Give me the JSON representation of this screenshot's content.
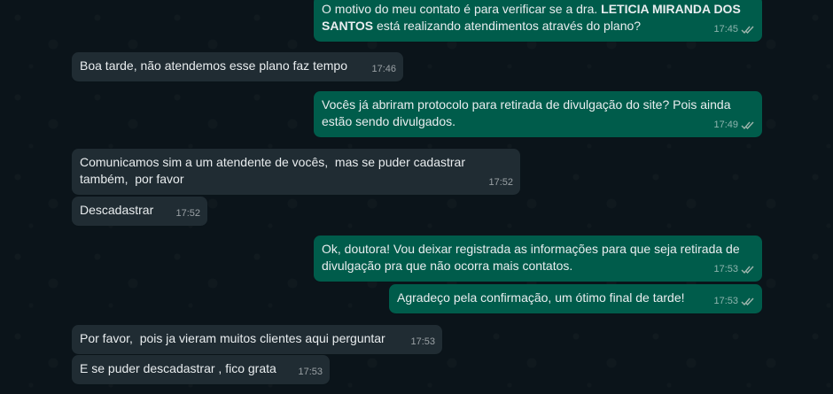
{
  "messages": [
    {
      "dir": "out",
      "pre": "O motivo do meu contato é para verificar se a dra. ",
      "bold": "LETICIA MIRANDA DOS SANTOS",
      "post": " está realizando atendimentos através do plano?",
      "time": "17:45"
    },
    {
      "dir": "in",
      "text": "Boa tarde, não atendemos esse plano faz tempo",
      "time": "17:46"
    },
    {
      "dir": "out",
      "text": "Vocês já abriram protocolo para retirada de divulgação do site? Pois ainda estão sendo divulgados.",
      "time": "17:49"
    },
    {
      "dir": "in",
      "text": "Comunicamos sim a um atendente de vocês,  mas se puder cadastrar também,  por favor",
      "time": "17:52"
    },
    {
      "dir": "in",
      "text": "Descadastrar",
      "time": "17:52"
    },
    {
      "dir": "out",
      "text": "Ok, doutora! Vou deixar registrada as informações para que seja retirada de divulgação pra que não ocorra mais contatos.",
      "time": "17:53"
    },
    {
      "dir": "out",
      "text": "Agradeço pela confirmação, um ótimo final de tarde!",
      "time": "17:53"
    },
    {
      "dir": "in",
      "text": "Por favor,  pois ja vieram muitos clientes aqui perguntar",
      "time": "17:53"
    },
    {
      "dir": "in",
      "text": "E se puder descadastrar , fico grata",
      "time": "17:53"
    }
  ],
  "colors": {
    "background": "#0b141a",
    "outgoing_bubble": "#005c4b",
    "incoming_bubble": "#202c33",
    "text": "#e9edef",
    "read_ticks": "#a0b6ae"
  },
  "icons": {
    "read_receipt": "double-check-icon"
  }
}
